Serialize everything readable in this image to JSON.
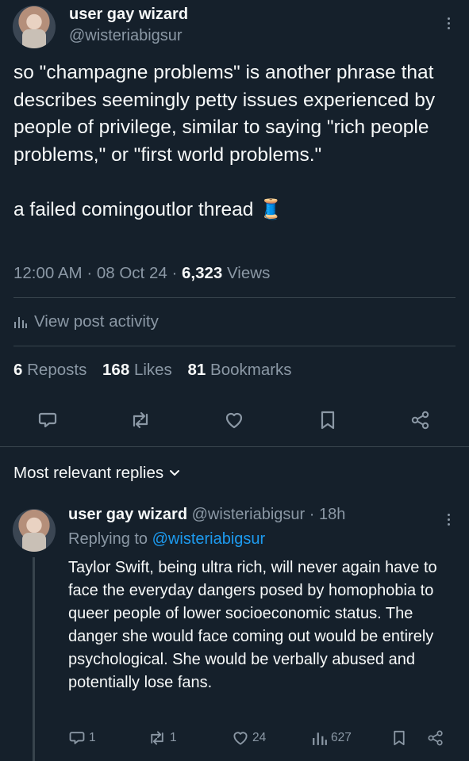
{
  "tweet": {
    "author_name": "user gay wizard",
    "author_handle": "@wisteriabigsur",
    "text": "so \"champagne problems\" is another phrase that describes seemingly petty issues experienced by people of privilege, similar to saying \"rich people problems,\" or \"first world problems.\"\n\na failed comingoutlor thread 🧵",
    "time": "12:00 AM",
    "date": "08 Oct 24",
    "views_count": "6,323",
    "views_label": "Views",
    "activity_label": "View post activity",
    "reposts_count": "6",
    "reposts_label": "Reposts",
    "likes_count": "168",
    "likes_label": "Likes",
    "bookmarks_count": "81",
    "bookmarks_label": "Bookmarks"
  },
  "replies_section": {
    "sort_label": "Most relevant replies"
  },
  "reply": {
    "author_name": "user gay wizard",
    "author_handle": "@wisteriabigsur",
    "time_ago": "18h",
    "replying_prefix": "Replying to",
    "replying_to": "@wisteriabigsur",
    "text": "Taylor Swift, being ultra rich, will never again have to face the everyday dangers posed by homophobia to queer people of lower socioeconomic status. The danger she would face coming out would be entirely psychological. She would be verbally abused and potentially lose fans.",
    "reply_count": "1",
    "repost_count": "1",
    "like_count": "24",
    "view_count": "627"
  },
  "icons": {
    "reply": "speech-bubble-icon",
    "repost": "repost-arrows-icon",
    "like": "heart-icon",
    "bookmark": "bookmark-icon",
    "share": "share-icon",
    "analytics": "bar-chart-icon",
    "more": "more-vertical-icon",
    "chevron": "chevron-down-icon"
  },
  "colors": {
    "background": "#15202b",
    "text": "#f7f9f9",
    "muted": "#8b98a5",
    "accent": "#1d9bf0",
    "divider": "#38444d"
  }
}
